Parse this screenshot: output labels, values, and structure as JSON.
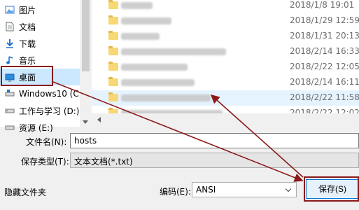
{
  "nav": {
    "items": [
      {
        "label": "图片",
        "icon": "pictures-icon"
      },
      {
        "label": "文档",
        "icon": "documents-icon"
      },
      {
        "label": "下载",
        "icon": "downloads-icon"
      },
      {
        "label": "音乐",
        "icon": "music-icon"
      },
      {
        "label": "桌面",
        "icon": "desktop-icon",
        "selected": true
      },
      {
        "label": "Windows10 (C:",
        "icon": "drive-icon"
      },
      {
        "label": "工作与学习 (D:)",
        "icon": "drive-icon"
      },
      {
        "label": "资源 (E:)",
        "icon": "drive-icon"
      }
    ]
  },
  "files": {
    "rows": [
      {
        "date": "2018/1/8 19:01"
      },
      {
        "date": "2018/1/29 12:59"
      },
      {
        "date": "2018/1/31 20:13"
      },
      {
        "date": "2018/2/14 16:33"
      },
      {
        "date": "2018/2/22 12:05"
      },
      {
        "date": "2018/2/14 16:11"
      },
      {
        "date": "2018/2/22 11:58",
        "selected": true
      },
      {
        "date": "2018/2/22 12:02"
      }
    ]
  },
  "form": {
    "filename_label": "文件名(N):",
    "filename_value": "hosts",
    "filetype_label": "保存类型(T):",
    "filetype_value": "文本文档(*.txt)",
    "hide_folders": "隐藏文件夹",
    "encoding_label": "编码(E):",
    "encoding_value": "ANSI",
    "save_button": "保存(S)"
  },
  "colors": {
    "annotation": "#8b1a1a",
    "selection": "#cce8ff",
    "accent": "#0078d7"
  }
}
